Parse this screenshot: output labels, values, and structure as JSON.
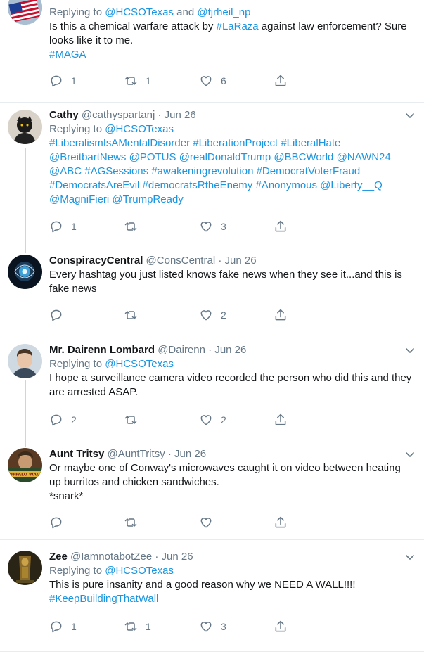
{
  "tweets": [
    {
      "reply_to_prefix": "Replying to",
      "reply_to_1": "@HCSOTexas",
      "reply_to_and": "and",
      "reply_to_2": "@tjrheil_np",
      "text_before": "Is this a chemical warfare attack by",
      "text_link": "#LaRaza",
      "text_after": "against law enforcement? Sure looks like it to me.",
      "text_tag": "#MAGA",
      "replies": "1",
      "retweets": "1",
      "likes": "6"
    },
    {
      "name": "Cathy",
      "handle": "@cathyspartanj",
      "time": "Jun 26",
      "reply_to_prefix": "Replying to",
      "reply_to": "@HCSOTexas",
      "tags": [
        "#LiberalismIsAMentalDisorder",
        "#LiberationProject",
        "#LiberalHate",
        "@BreitbartNews",
        "@POTUS",
        "@realDonaldTrump",
        "@BBCWorld",
        "@NAWN24",
        "@ABC",
        "#AGSessions",
        "#awakeningrevolution",
        "#DemocratVoterFraud",
        "#DemocratsAreEvil",
        "#democratsRtheEnemy",
        "#Anonymous",
        "@Liberty__Q",
        "@MagniFieri",
        "@TrumpReady"
      ],
      "replies": "1",
      "retweets": "",
      "likes": "3"
    },
    {
      "name": "ConspiracyCentral",
      "handle": "@ConsCentral",
      "time": "Jun 26",
      "text": "Every hashtag you just listed knows fake news when they see it...and this is fake news",
      "replies": "",
      "retweets": "",
      "likes": "2"
    },
    {
      "name": "Mr. Dairenn Lombard",
      "handle": "@Dairenn",
      "time": "Jun 26",
      "reply_to_prefix": "Replying to",
      "reply_to": "@HCSOTexas",
      "text": "I hope a surveillance camera video recorded the person who did this and they are arrested ASAP.",
      "replies": "2",
      "retweets": "",
      "likes": "2"
    },
    {
      "name": "Aunt Tritsy",
      "handle": "@AuntTritsy",
      "time": "Jun 26",
      "text": "Or maybe one of Conway's microwaves caught it on video between heating up burritos and chicken sandwiches.",
      "text2": "*snark*",
      "avatar_text": "UFFALO WAG",
      "replies": "",
      "retweets": "",
      "likes": ""
    },
    {
      "name": "Zee",
      "handle": "@IamnotabotZee",
      "time": "Jun 26",
      "reply_to_prefix": "Replying to",
      "reply_to": "@HCSOTexas",
      "text": "This is pure insanity and a good reason why we NEED A WALL!!!!",
      "text_tag": "#KeepBuildingThatWall",
      "replies": "1",
      "retweets": "1",
      "likes": "3"
    }
  ],
  "separator": "·",
  "colors": {
    "link": "#1b95e0",
    "secondary": "#657786",
    "divider": "#e6ecf0",
    "thread_line": "#ccd6dd"
  },
  "icons": {
    "reply": "reply-icon",
    "retweet": "retweet-icon",
    "like": "heart-icon",
    "share": "share-icon",
    "menu": "chevron-down-icon"
  }
}
